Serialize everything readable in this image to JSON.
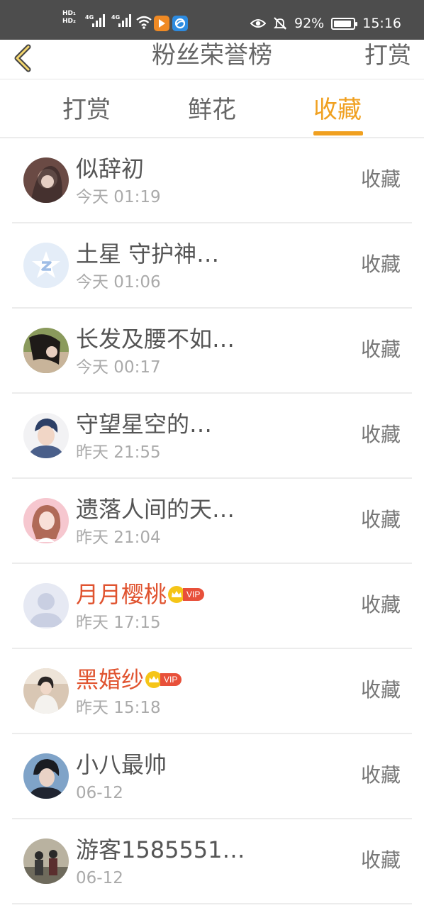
{
  "status_bar": {
    "hd1": "HD₁",
    "hd2": "HD₂",
    "net1": "4G",
    "net2": "4G",
    "battery_text": "92%",
    "battery_level": 0.92,
    "time": "15:16",
    "icons": [
      "signal-icon",
      "signal-icon",
      "wifi-icon",
      "app-notification-icon",
      "app-notification-icon",
      "eye-icon",
      "mute-bell-icon",
      "battery-icon"
    ]
  },
  "header": {
    "title": "粉丝荣誉榜",
    "action": "打赏",
    "back_icon": "chevron-left-icon"
  },
  "tabs": [
    {
      "label": "打赏",
      "active": false
    },
    {
      "label": "鲜花",
      "active": false
    },
    {
      "label": "收藏",
      "active": true
    }
  ],
  "colors": {
    "accent": "#f0a020",
    "vip_name": "#e0532f",
    "status_bar": "#4d4d4d"
  },
  "vip_label": "VIP",
  "fans": [
    {
      "name": "似辞初",
      "time": "今天 01:19",
      "action": "收藏",
      "vip": false
    },
    {
      "name": "土星 守护神…",
      "time": "今天 01:06",
      "action": "收藏",
      "vip": false
    },
    {
      "name": "长发及腰不如…",
      "time": "今天 00:17",
      "action": "收藏",
      "vip": false
    },
    {
      "name": "守望星空的…",
      "time": "昨天 21:55",
      "action": "收藏",
      "vip": false
    },
    {
      "name": "遗落人间的天…",
      "time": "昨天 21:04",
      "action": "收藏",
      "vip": false
    },
    {
      "name": "月月樱桃",
      "time": "昨天 17:15",
      "action": "收藏",
      "vip": true
    },
    {
      "name": "黑婚纱",
      "time": "昨天 15:18",
      "action": "收藏",
      "vip": true
    },
    {
      "name": "小八最帅",
      "time": "06-12",
      "action": "收藏",
      "vip": false
    },
    {
      "name": "游客1585551…",
      "time": "06-12",
      "action": "收藏",
      "vip": false
    }
  ]
}
